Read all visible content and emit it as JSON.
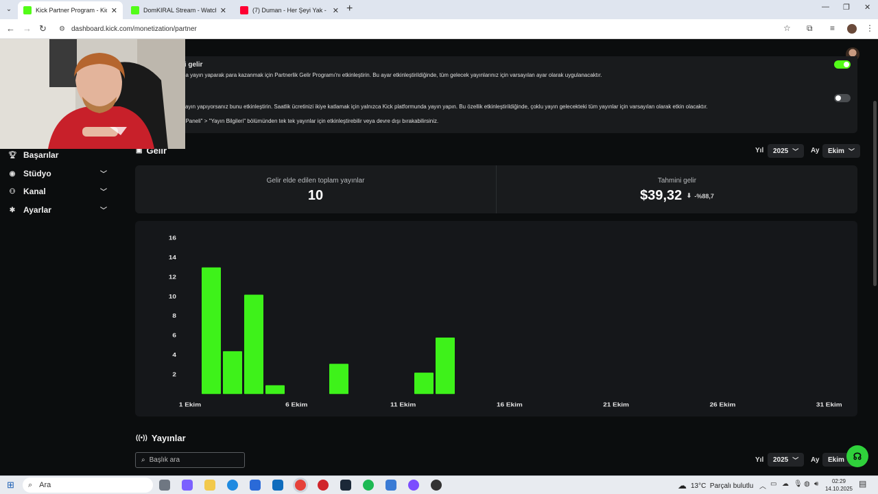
{
  "browser": {
    "tabs": [
      {
        "title": "Kick Partner Program - Kick Da",
        "active": true
      },
      {
        "title": "DomKIRAL Stream - Watch Live",
        "active": false
      },
      {
        "title": "(7) Duman - Her Şeyi Yak -",
        "active": false
      }
    ],
    "url": "dashboard.kick.com/monetization/partner"
  },
  "sidebar": {
    "items": [
      {
        "label": "Başarılar",
        "icon": "trophy-icon"
      },
      {
        "label": "Stüdyo",
        "icon": "studio-icon"
      },
      {
        "label": "Kanal",
        "icon": "channel-icon"
      },
      {
        "label": "Ayarlar",
        "icon": "gear-icon"
      }
    ]
  },
  "settings": {
    "partial_title": "li gelir",
    "line1": "da yayın yaparak para kazanmak için Partnerlik Gelir Programı'nı etkinleştirin. Bu ayar etkinleştirildiğinde, tüm gelecek yayınlarınız için varsayılan ayar olarak uygulanacaktır.",
    "line2": "yayın yapıyorsanız bunu etkinleştirin. Saatlik ücretinizi ikiye katlamak için yalnızca Kick platformunda yayın yapın. Bu özellik etkinleştirildiğinde, çoklu yayın gelecekteki tüm yayınlar için varsayılan olarak etkin olacaktır.",
    "line3": "ı Paneli\" > \"Yayın Bilgileri\" bölümünden tek tek yayınlar için etkinleştirebilir veya devre dışı bırakabilirsiniz.",
    "toggle1_on": true,
    "toggle2_on": false
  },
  "revenue": {
    "title": "Gelir",
    "year_label": "Yıl",
    "year_value": "2025",
    "month_label": "Ay",
    "month_value": "Ekim",
    "total_streams_label": "Gelir elde edilen toplam yayınlar",
    "total_streams_value": "10",
    "estimated_label": "Tahmini gelir",
    "estimated_value": "$39,32",
    "estimated_change": "-%88,7"
  },
  "chart_data": {
    "type": "bar",
    "x": [
      1,
      2,
      3,
      4,
      5,
      6,
      7,
      8,
      9,
      10,
      11,
      12,
      13,
      14,
      15,
      16,
      17,
      18,
      19,
      20,
      21,
      22,
      23,
      24,
      25,
      26,
      27,
      28,
      29,
      30,
      31
    ],
    "values": [
      13,
      4.4,
      10.2,
      0.9,
      0,
      0,
      3.1,
      0,
      0,
      0,
      2.2,
      5.8,
      0,
      0,
      0,
      0,
      0,
      0,
      0,
      0,
      0,
      0,
      0,
      0,
      0,
      0,
      0,
      0,
      0,
      0,
      0
    ],
    "x_tick_labels": [
      "1 Ekim",
      "6 Ekim",
      "11 Ekim",
      "16 Ekim",
      "21 Ekim",
      "26 Ekim",
      "31 Ekim"
    ],
    "y_tick_labels": [
      "2",
      "4",
      "6",
      "8",
      "10",
      "12",
      "14",
      "16"
    ],
    "ylim": [
      0,
      16
    ],
    "bar_color": "#3ef21a",
    "grid": false
  },
  "streams": {
    "title": "Yayınlar",
    "search_placeholder": "Başlık ara",
    "year_label": "Yıl",
    "year_value": "2025",
    "month_label": "Ay",
    "month_value": "Ekim"
  },
  "taskbar": {
    "search_placeholder": "Ara",
    "weather_temp": "13°C",
    "weather_desc": "Parçalı bulutlu",
    "time": "02:29",
    "date": "14.10.2025"
  },
  "colors": {
    "accent": "#53fc18",
    "bar": "#3ef21a"
  }
}
